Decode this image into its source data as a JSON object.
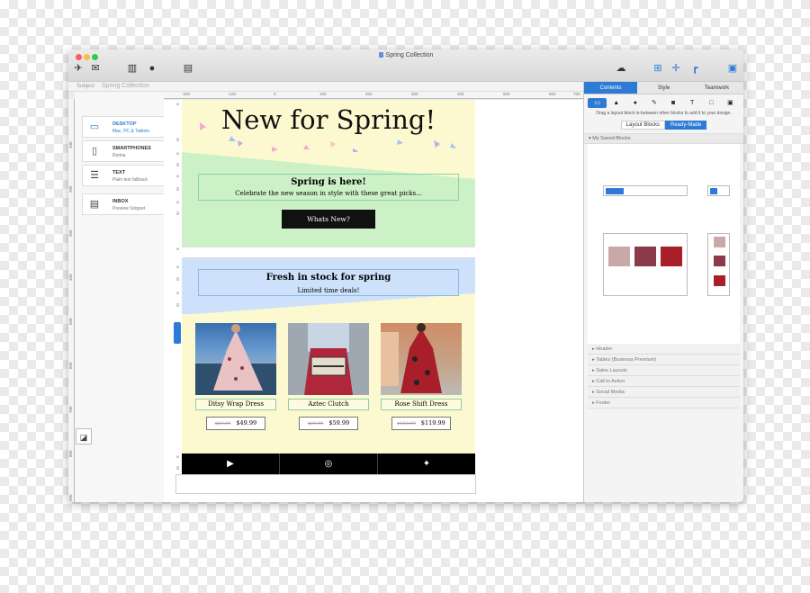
{
  "window": {
    "title": "Spring Collection"
  },
  "toolbar": {
    "icons": [
      "logo-icon",
      "campaign-icon",
      "devices-icon",
      "check-icon",
      "chat-icon",
      "cloud-icon",
      "layout-icon",
      "move-icon",
      "corner-icon",
      "sidebar-icon"
    ]
  },
  "subject": {
    "label": "Subject",
    "value": "Spring Collection"
  },
  "ruler": {
    "top": [
      "-200",
      "-100",
      "0",
      "100",
      "200",
      "300",
      "400",
      "500",
      "600",
      "700",
      "800"
    ],
    "left": [
      "100",
      "200",
      "300",
      "400",
      "500",
      "600",
      "700",
      "800",
      "900",
      "1000"
    ]
  },
  "devices": [
    {
      "name": "DESKTOP",
      "sub": "Mac, PC & Tablets"
    },
    {
      "name": "SMARTPHONES",
      "sub": "Retina"
    },
    {
      "name": "TEXT",
      "sub": "Plain text fallback"
    },
    {
      "name": "INBOX",
      "sub": "Preview Snippet"
    }
  ],
  "email": {
    "headline": "New for Spring!",
    "spring_title": "Spring is here!",
    "spring_sub": "Celebrate the new season in style with these great picks...",
    "cta": "Whats New?",
    "fresh_title": "Fresh in stock for spring",
    "fresh_sub": "Limited time deals!",
    "products": [
      {
        "name": "Ditsy Wrap Dress",
        "old": "$69.99",
        "price": "$49.99"
      },
      {
        "name": "Aztec Clutch",
        "old": "$69.99",
        "price": "$59.99"
      },
      {
        "name": "Rose Shift Dress",
        "old": "$159.99",
        "price": "$119.99"
      }
    ],
    "social": [
      "youtube-icon",
      "instagram-icon",
      "twitter-icon"
    ]
  },
  "panel": {
    "tabs": [
      "Contents",
      "Style",
      "Teamwork"
    ],
    "hint": "Drag a layout block in-between other blocks to add it to your design.",
    "seg": [
      "Layout Blocks",
      "Ready-Made"
    ],
    "saved": "My Saved Blocks",
    "categories": [
      "Header",
      "Tables (Business Premium)",
      "Sales Layouts",
      "Call to Action",
      "Social Media",
      "Footer"
    ]
  },
  "colors": {
    "accent": "#2d7bd6",
    "yellow": "#fcf8d0",
    "green": "#cdf1c7",
    "blue": "#cde2fa"
  }
}
